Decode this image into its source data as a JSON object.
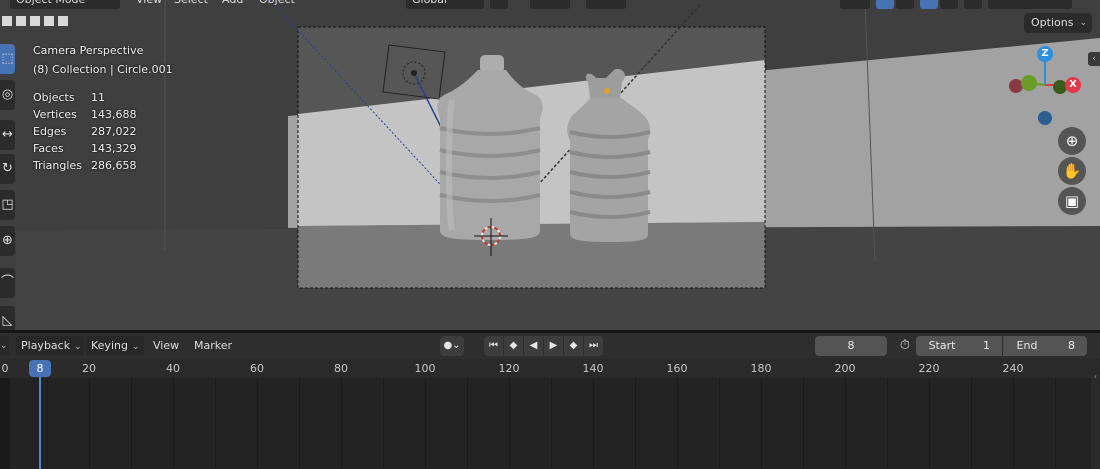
{
  "viewport": {
    "header": {
      "mode_label": "Object Mode",
      "menus": [
        "View",
        "Select",
        "Add",
        "Object"
      ],
      "orientation_label": "Global"
    },
    "options_label": "Options",
    "overlay": {
      "view_name": "Camera Perspective",
      "collection": "(8) Collection | Circle.001"
    },
    "stats": [
      {
        "name": "Objects",
        "value": "11"
      },
      {
        "name": "Vertices",
        "value": "143,688"
      },
      {
        "name": "Edges",
        "value": "287,022"
      },
      {
        "name": "Faces",
        "value": "143,329"
      },
      {
        "name": "Triangles",
        "value": "286,658"
      }
    ],
    "gizmo": {
      "x": "X",
      "y": "Y",
      "z": "Z"
    },
    "tool_icons": [
      "select-box-icon",
      "cursor-icon",
      "move-icon",
      "rotate-icon",
      "scale-icon",
      "transform-icon",
      "annotate-icon",
      "measure-icon"
    ]
  },
  "timeline": {
    "menus": [
      {
        "label": "Playback",
        "dropdown": true
      },
      {
        "label": "Keying",
        "dropdown": true
      },
      {
        "label": "View",
        "dropdown": false
      },
      {
        "label": "Marker",
        "dropdown": false
      }
    ],
    "current_frame": "8",
    "start_label": "Start",
    "start_value": "1",
    "end_label": "End",
    "end_value": "8",
    "playhead_label": "8",
    "ruler_ticks": [
      "0",
      "20",
      "40",
      "60",
      "80",
      "100",
      "120",
      "140",
      "160",
      "180",
      "200",
      "220",
      "240"
    ]
  },
  "colors": {
    "accent": "#4772b3",
    "playhead": "#4e87d0",
    "gizmo_x": "#e0384c",
    "gizmo_y": "#6b9c27",
    "gizmo_z": "#2c8fe0"
  }
}
